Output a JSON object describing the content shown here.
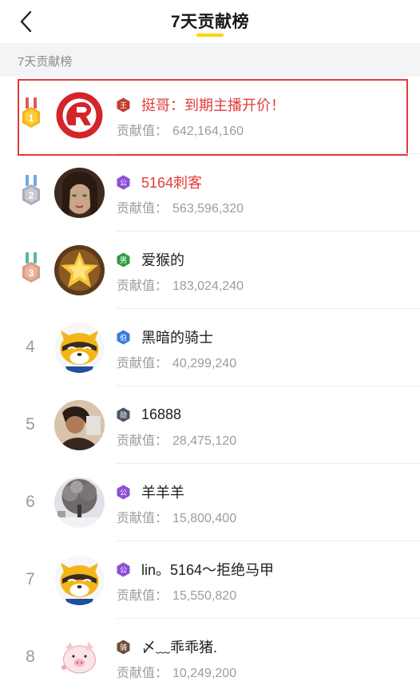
{
  "header": {
    "title": "7天贡献榜",
    "back_icon": "chevron-left-icon",
    "accent": "#ffd400"
  },
  "section": {
    "label": "7天贡献榜"
  },
  "contrib_label": "贡献值：",
  "rows": [
    {
      "rank": "1",
      "medal": "gold",
      "badge": "王",
      "badge_color": "#c43c2e",
      "name": "挺哥：到期主播开价！",
      "name_red": true,
      "value": "642,164,160",
      "highlight": true,
      "avatar": "logo-avatar"
    },
    {
      "rank": "2",
      "medal": "silver",
      "badge": "公",
      "badge_color": "#8a4fd8",
      "name": "5164刺客",
      "name_red": true,
      "value": "563,596,320",
      "avatar": "woman-avatar"
    },
    {
      "rank": "3",
      "medal": "bronze",
      "badge": "男",
      "badge_color": "#2f9e44",
      "name": "爱猴的",
      "name_red": false,
      "value": "183,024,240",
      "avatar": "star-avatar"
    },
    {
      "rank": "4",
      "badge": "伯",
      "badge_color": "#3a7bdc",
      "name": "黑暗的骑士",
      "name_red": false,
      "value": "40,299,240",
      "avatar": "raccoon-avatar"
    },
    {
      "rank": "5",
      "badge": "勋",
      "badge_color": "#4b5563",
      "name": "16888",
      "name_red": false,
      "value": "28,475,120",
      "avatar": "photo-avatar"
    },
    {
      "rank": "6",
      "badge": "公",
      "badge_color": "#8a4fd8",
      "name": "羊羊羊",
      "name_red": false,
      "value": "15,800,400",
      "avatar": "tree-avatar"
    },
    {
      "rank": "7",
      "badge": "公",
      "badge_color": "#8a4fd8",
      "name": "lin。5164～拒绝马甲",
      "name_red": false,
      "value": "15,550,820",
      "avatar": "raccoon-avatar"
    },
    {
      "rank": "8",
      "badge": "骑",
      "badge_color": "#6b4f3a",
      "name": "〆﹏乖乖猪.",
      "name_red": false,
      "value": "10,249,200",
      "avatar": "pig-avatar"
    }
  ]
}
